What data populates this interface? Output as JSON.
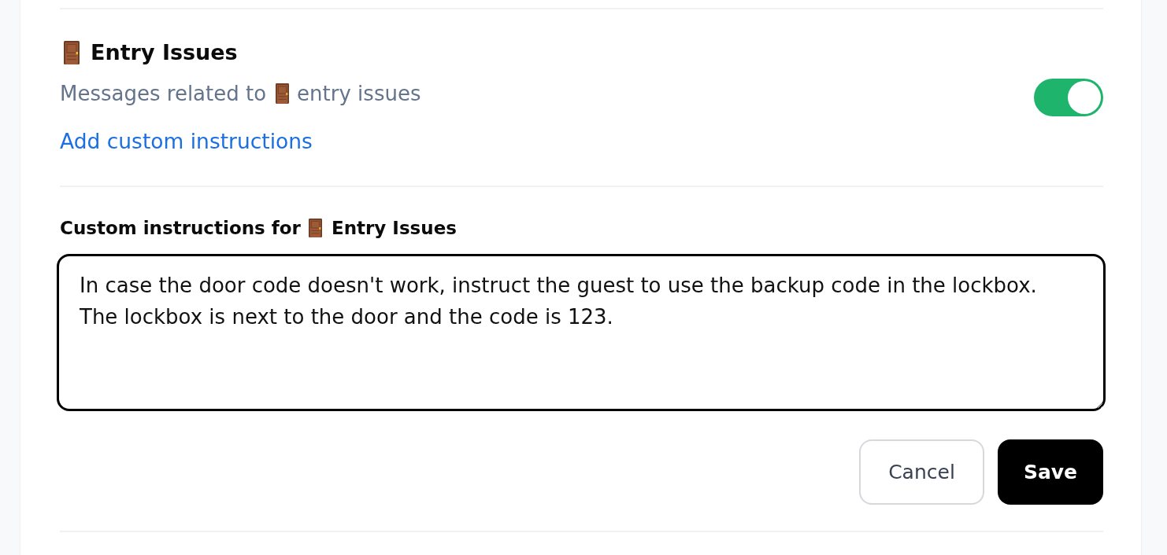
{
  "section": {
    "title": "Entry Issues",
    "description": [
      "Messages related to",
      "entry issues"
    ],
    "enabled": true,
    "link": "Add custom instructions"
  },
  "editor": {
    "label": [
      "Custom instructions for",
      "Entry Issues"
    ],
    "value": "In case the door code doesn't work, instruct the guest to use the backup code in the lockbox.\nThe lockbox is next to the door and the code is 123.",
    "buttons": [
      {
        "label": "Cancel",
        "kind": "secondary"
      },
      {
        "label": "Save",
        "kind": "primary"
      }
    ]
  }
}
